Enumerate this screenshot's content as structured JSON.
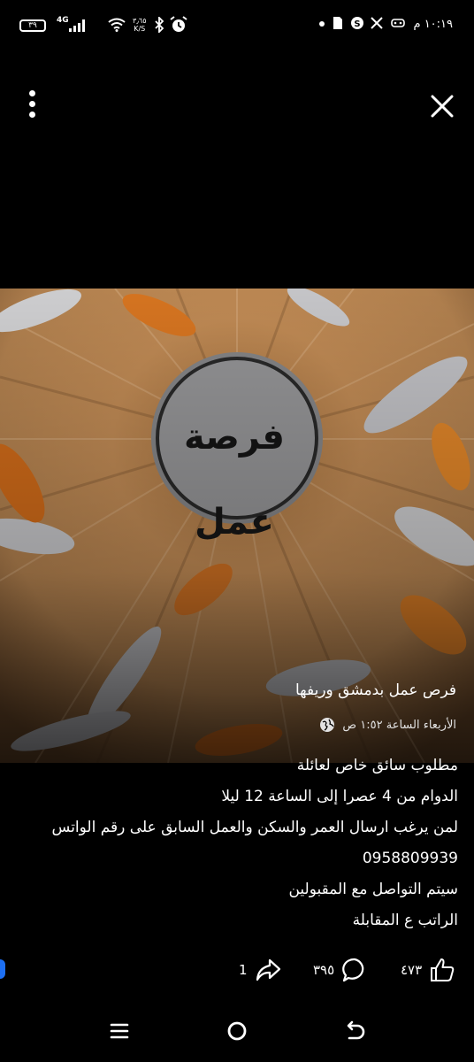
{
  "status_bar": {
    "time": "١٠:١٩ م",
    "battery": "٣٩",
    "network": "4G",
    "speed_value": "٣٫٦٥",
    "speed_unit": "K/S",
    "icons": [
      "alarm-icon",
      "bluetooth-icon",
      "wifi-icon",
      "signal-icon",
      "battery-icon",
      "document-icon",
      "skype-icon",
      "x-icon",
      "messenger-icon",
      "dot-icon"
    ]
  },
  "viewer": {
    "logo_text": "فرصة عمل"
  },
  "post": {
    "group_name": "فرص عمل بدمشق وريفها",
    "timestamp": "الأربعاء الساعة ١:٥٢ ص",
    "lines": [
      "مطلوب سائق خاص لعائلة",
      "الدوام من 4 عصرا إلى الساعة 12 ليلا",
      "لمن يرغب ارسال العمر والسكن والعمل السابق على رقم الواتس",
      "0958809939",
      "سيتم التواصل مع المقبولين",
      "الراتب ع المقابلة"
    ]
  },
  "actions": {
    "likes": "٤٧٣",
    "comments": "٣٩٥",
    "shares": "1"
  },
  "colors": {
    "background": "#000000",
    "accent": "#1d6ff2",
    "fur": "#c98f4c",
    "feather_orange": "#e07a22"
  }
}
